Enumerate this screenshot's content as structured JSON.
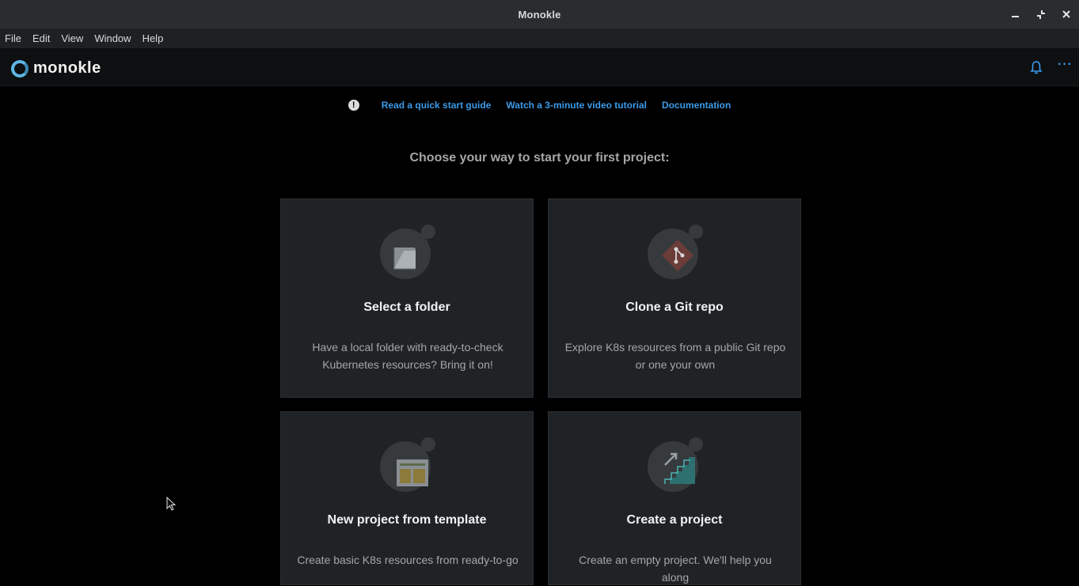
{
  "window": {
    "title": "Monokle"
  },
  "menubar": {
    "items": [
      "File",
      "Edit",
      "View",
      "Window",
      "Help"
    ]
  },
  "header": {
    "logo_text": "monokle"
  },
  "links": {
    "quick_start": "Read a quick start guide",
    "video": "Watch a 3-minute video tutorial",
    "docs": "Documentation"
  },
  "headline": "Choose your way to start your first project:",
  "cards": [
    {
      "title": "Select a folder",
      "description": "Have a local folder with ready-to-check Kubernetes resources? Bring it on!",
      "icon": "folder-icon"
    },
    {
      "title": "Clone a Git repo",
      "description": "Explore K8s resources from a public Git repo or one your own",
      "icon": "git-icon"
    },
    {
      "title": "New project from template",
      "description": "Create basic K8s resources from ready-to-go",
      "icon": "template-icon"
    },
    {
      "title": "Create a project",
      "description": "Create an empty project. We'll help you along",
      "icon": "stairs-icon"
    }
  ],
  "colors": {
    "accent": "#3c9ae8",
    "card_bg": "#1f2326",
    "titlebar": "#2a2d30"
  }
}
